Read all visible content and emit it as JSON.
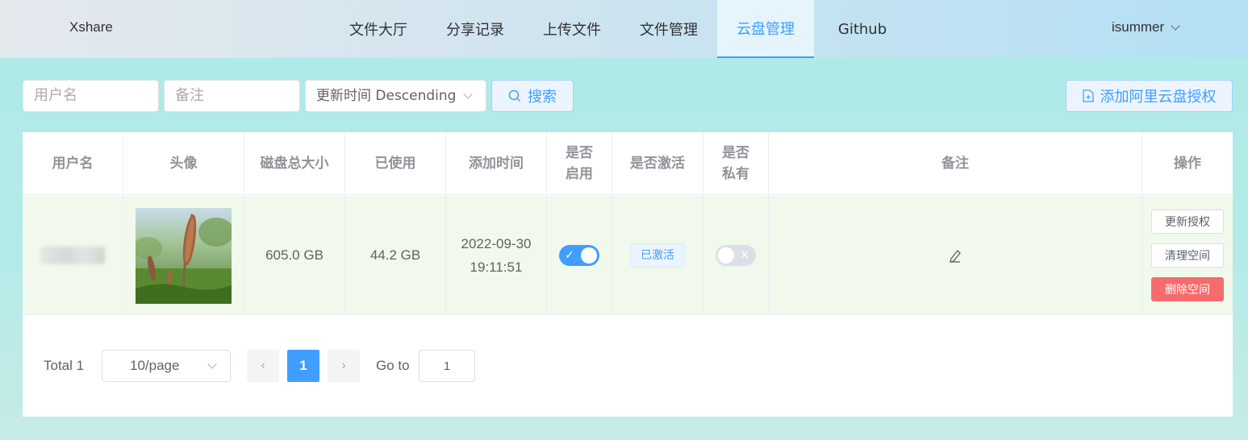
{
  "header": {
    "brand": "Xshare",
    "nav": [
      {
        "label": "文件大厅"
      },
      {
        "label": "分享记录"
      },
      {
        "label": "上传文件"
      },
      {
        "label": "文件管理"
      },
      {
        "label": "云盘管理",
        "active": true
      },
      {
        "label": "Github"
      }
    ],
    "user": "isummer"
  },
  "toolbar": {
    "username_placeholder": "用户名",
    "remark_placeholder": "备注",
    "sort_value": "更新时间 Descending",
    "search_label": "搜索",
    "add_label": "添加阿里云盘授权"
  },
  "table": {
    "headers": [
      "用户名",
      "头像",
      "磁盘总大小",
      "已使用",
      "添加时间",
      "是否\n启用",
      "是否激活",
      "是否\n私有",
      "备注",
      "操作"
    ],
    "rows": [
      {
        "username": "",
        "disk_total": "605.0 GB",
        "used": "44.2 GB",
        "added_date": "2022-09-30",
        "added_time": "19:11:51",
        "enabled": true,
        "active_tag": "已激活",
        "private": false,
        "actions": [
          "更新授权",
          "清理空间",
          "删除空间"
        ]
      }
    ]
  },
  "pagination": {
    "total": "Total 1",
    "page_size": "10/page",
    "current": "1",
    "goto_label": "Go to",
    "goto_value": "1"
  },
  "colors": {
    "primary": "#409eff",
    "danger": "#f56c6c",
    "row_highlight": "#f0f9eb"
  }
}
